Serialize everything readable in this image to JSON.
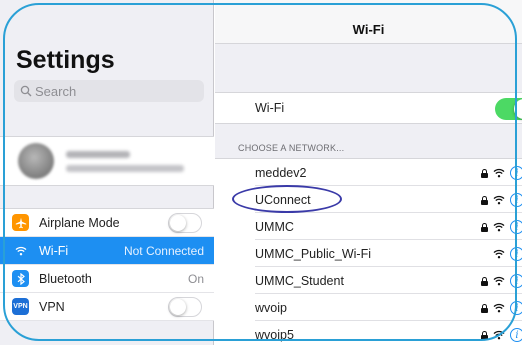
{
  "sidebar": {
    "title": "Settings",
    "search_placeholder": "Search",
    "items": [
      {
        "label": "Airplane Mode",
        "icon": "airplane-icon",
        "icon_color": "#ff9500",
        "value": ""
      },
      {
        "label": "Wi-Fi",
        "icon": "wifi-icon",
        "icon_color": "#1d8ff2",
        "value": "Not Connected"
      },
      {
        "label": "Bluetooth",
        "icon": "bluetooth-icon",
        "icon_color": "#1d8ff2",
        "value": "On"
      },
      {
        "label": "VPN",
        "icon": "vpn-icon",
        "icon_color": "#1d6fd6",
        "value": ""
      }
    ],
    "vpn_icon_text": "VPN"
  },
  "main": {
    "nav_title": "Wi-Fi",
    "wifi_label": "Wi-Fi",
    "wifi_enabled": true,
    "section_header": "CHOOSE A NETWORK...",
    "networks": [
      {
        "name": "meddev2",
        "secured": true
      },
      {
        "name": "UConnect",
        "secured": true
      },
      {
        "name": "UMMC",
        "secured": true
      },
      {
        "name": "UMMC_Public_Wi-Fi",
        "secured": false
      },
      {
        "name": "UMMC_Student",
        "secured": true
      },
      {
        "name": "wvoip",
        "secured": true
      },
      {
        "name": "wvoip5",
        "secured": true
      }
    ]
  },
  "colors": {
    "accent": "#1d8ff2",
    "toggle_on": "#4cd964",
    "highlight_circle": "#3a3aa8",
    "frame_border": "#2aa0d6"
  }
}
